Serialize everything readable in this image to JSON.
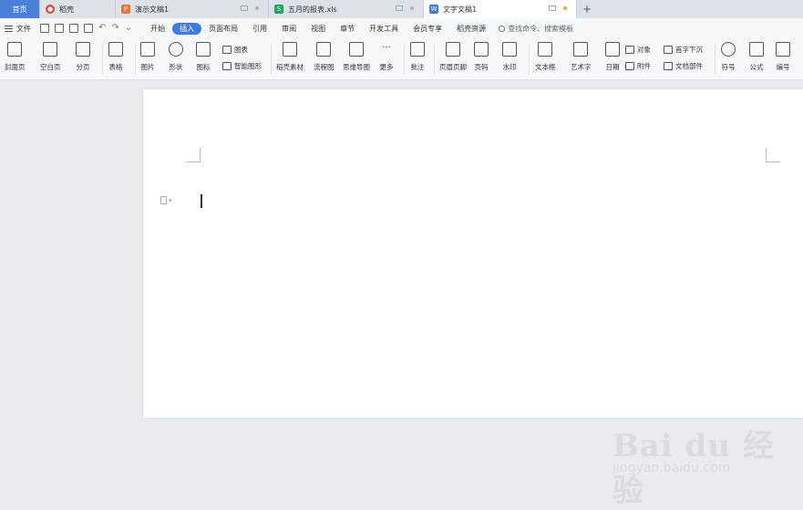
{
  "tabs": [
    {
      "label": "首页",
      "type": "home"
    },
    {
      "label": "稻壳",
      "icon": "daoke-icon",
      "color": "#e8443a"
    },
    {
      "label": "演示文稿1",
      "icon": "presentation-icon",
      "color": "#e8733a"
    },
    {
      "label": "五月的报表.xls",
      "icon": "spreadsheet-icon",
      "color": "#1fa35c"
    },
    {
      "label": "文字文稿1",
      "icon": "document-icon",
      "color": "#3c7be0",
      "active": true
    }
  ],
  "new_tab_label": "+",
  "menu": {
    "file_label": "文件",
    "items": [
      "开始",
      "插入",
      "页面布局",
      "引用",
      "审阅",
      "视图",
      "章节",
      "开发工具",
      "会员专享",
      "稻壳资源"
    ],
    "active": "插入",
    "search_label": "查找命令、搜索模板"
  },
  "ribbon": {
    "cover_page": "封面页",
    "blank_page": "空白页",
    "page_break": "分页",
    "table": "表格",
    "picture": "图片",
    "shape": "形状",
    "icon": "图标",
    "chart": "图表",
    "smart_art": "智能图形",
    "daoke_material": "稻壳素材",
    "flowchart": "流程图",
    "mindmap": "思维导图",
    "more": "更多",
    "comment": "批注",
    "header_footer": "页眉页脚",
    "page_number": "页码",
    "watermark": "水印",
    "textbox": "文本框",
    "wordart": "艺术字",
    "date": "日期",
    "object": "对象",
    "attachment": "附件",
    "drop_cap": "首字下沉",
    "doc_parts": "文档部件",
    "symbol": "符号",
    "formula": "公式",
    "numbering": "编号"
  },
  "watermark": {
    "logo_text": "Bai du 经验",
    "url": "jingyan.baidu.com"
  },
  "colors": {
    "active_tab_home": "#4a80d9",
    "active_menu": "#3c7be0",
    "modified_dot": "#f5a623"
  }
}
